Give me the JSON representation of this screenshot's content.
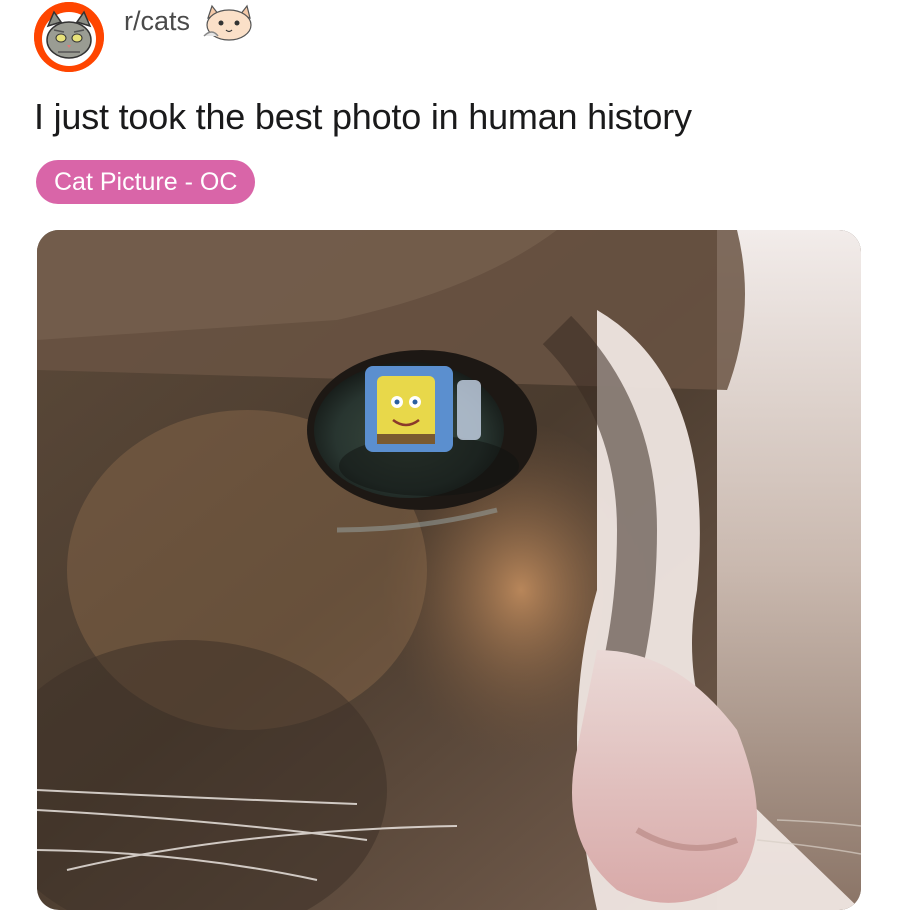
{
  "post": {
    "subreddit": "r/cats",
    "title": "I just took the best photo in human history",
    "flair": "Cat Picture - OC",
    "flair_color": "#d965a8"
  },
  "icons": {
    "avatar": "cat-avatar-icon",
    "badge": "cat-badge-icon"
  },
  "colors": {
    "avatar_ring": "#ff4500",
    "text_primary": "#1a1a1b",
    "text_secondary": "#4a4a4a"
  }
}
